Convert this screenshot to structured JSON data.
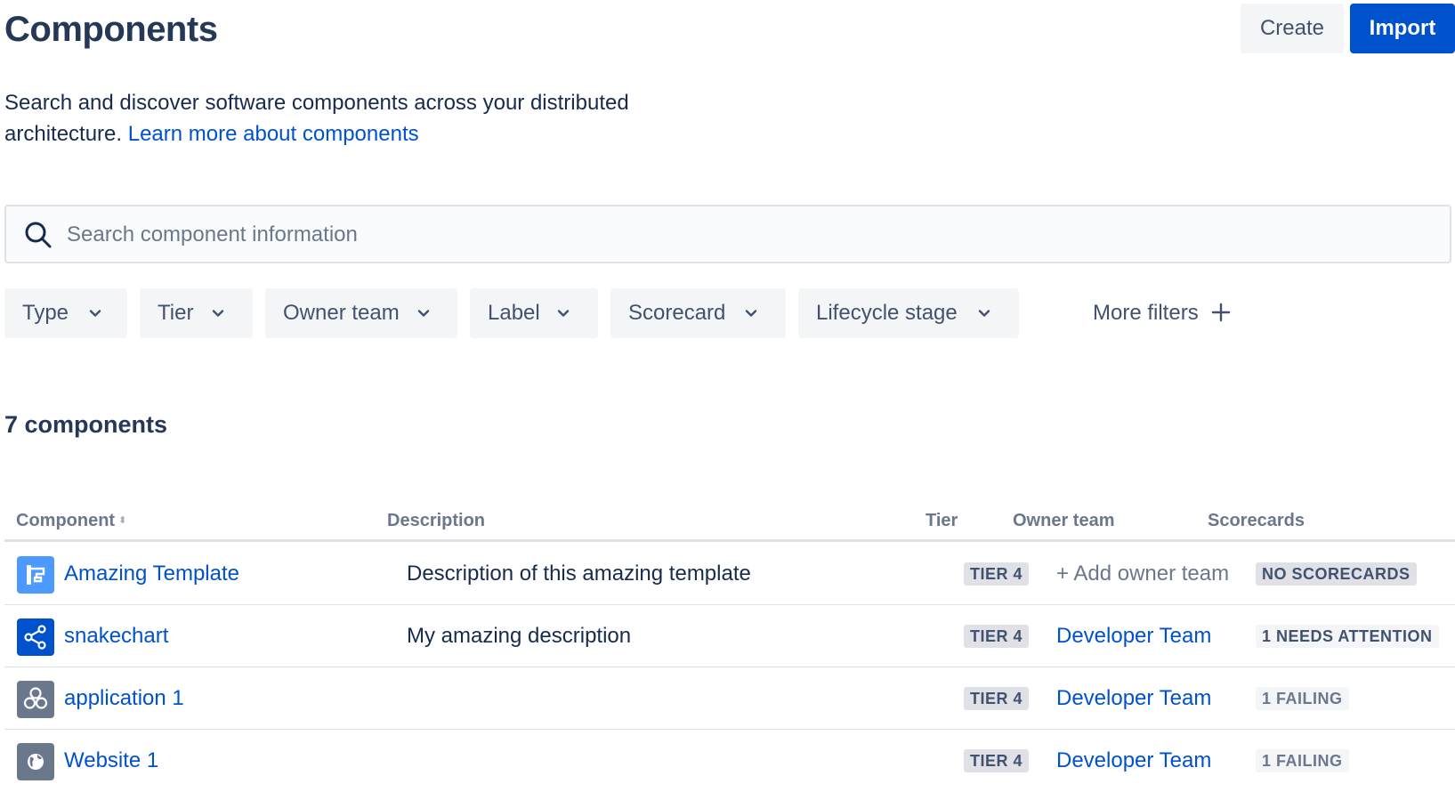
{
  "header": {
    "title": "Components",
    "create_label": "Create",
    "import_label": "Import"
  },
  "intro": {
    "text": "Search and discover software components across your distributed architecture.",
    "link": "Learn more about components"
  },
  "search": {
    "placeholder": "Search component information",
    "value": ""
  },
  "filters": {
    "items": [
      "Type",
      "Tier",
      "Owner team",
      "Label",
      "Scorecard",
      "Lifecycle stage"
    ],
    "more_label": "More filters"
  },
  "results": {
    "count_label": "7 components"
  },
  "table": {
    "columns": [
      "Component",
      "Description",
      "Tier",
      "Owner team",
      "Scorecards"
    ],
    "rows": [
      {
        "icon": "template-icon",
        "icon_color": "#4c9aff",
        "name": "Amazing Template",
        "description": "Description of this amazing template",
        "tier": "TIER 4",
        "owner": "+ Add owner team",
        "scorecard": "NO SCORECARDS"
      },
      {
        "icon": "share-graph-icon",
        "icon_color": "#0052cc",
        "name": "snakechart",
        "description": "My amazing description",
        "tier": "TIER 4",
        "owner": "Developer Team",
        "scorecard": "1 NEEDS ATTENTION"
      },
      {
        "icon": "hexagons-icon",
        "icon_color": "#6b778c",
        "name": "application 1",
        "description": "",
        "tier": "TIER 4",
        "owner": "Developer Team",
        "scorecard": "1 FAILING"
      },
      {
        "icon": "globe-icon",
        "icon_color": "#6b778c",
        "name": "Website 1",
        "description": "",
        "tier": "TIER 4",
        "owner": "Developer Team",
        "scorecard": "1 FAILING"
      }
    ]
  },
  "colors": {
    "primary": "#0052cc",
    "text": "#172b4d",
    "subtle": "#6b778c",
    "neutral_bg": "#f4f5f7",
    "border": "#dfe1e6"
  }
}
